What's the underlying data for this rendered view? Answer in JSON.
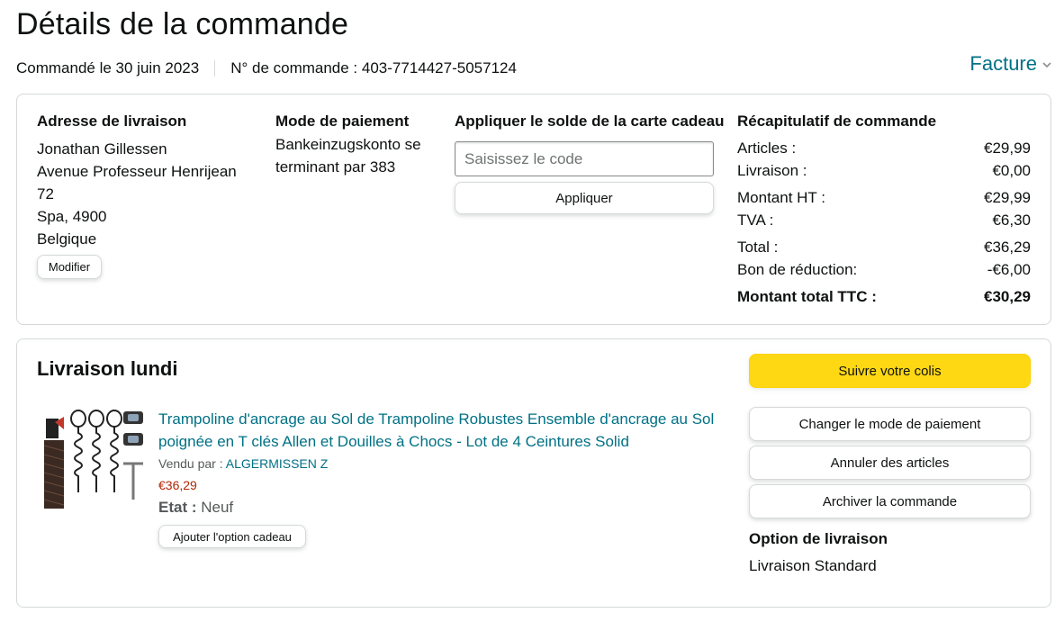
{
  "page": {
    "title": "Détails de la commande",
    "ordered_on": "Commandé le 30 juin 2023",
    "order_number": "N° de commande : 403-7714427-5057124",
    "invoice_label": "Facture"
  },
  "shipping_address": {
    "title": "Adresse de livraison",
    "lines": [
      "Jonathan Gillessen",
      "Avenue Professeur Henrijean",
      "72",
      "Spa, 4900",
      "Belgique"
    ],
    "edit_label": "Modifier"
  },
  "payment": {
    "title": "Mode de paiement",
    "lines": [
      "Bankeinzugskonto se",
      "terminant par 383"
    ]
  },
  "gift_card": {
    "title": "Appliquer le solde de la carte cadeau",
    "placeholder": "Saisissez le code",
    "apply_label": "Appliquer"
  },
  "summary": {
    "title": "Récapitulatif de commande",
    "rows": [
      {
        "label": "Articles :",
        "value": "€29,99"
      },
      {
        "label": "Livraison :",
        "value": "€0,00"
      },
      {
        "label": "Montant HT :",
        "value": "€29,99"
      },
      {
        "label": "TVA :",
        "value": "€6,30"
      },
      {
        "label": "Total :",
        "value": "€36,29"
      },
      {
        "label": "Bon de réduction:",
        "value": "-€6,00"
      },
      {
        "label": "Montant total TTC :",
        "value": "€30,29"
      }
    ]
  },
  "shipment": {
    "title": "Livraison lundi",
    "product": {
      "title": "Trampoline d'ancrage au Sol de Trampoline Robustes Ensemble d'ancrage au Sol poignée en T clés Allen et Douilles à Chocs - Lot de 4 Ceintures Solid",
      "sold_by_label": "Vendu par : ",
      "seller": "ALGERMISSEN Z",
      "price": "€36,29",
      "condition_label": "Etat : ",
      "condition": "Neuf",
      "gift_label": "Ajouter l'option cadeau"
    },
    "actions": {
      "track": "Suivre votre colis",
      "change_payment": "Changer le mode de paiement",
      "cancel_items": "Annuler des articles",
      "archive": "Archiver la commande"
    },
    "delivery_option_title": "Option de livraison",
    "delivery_option_value": "Livraison Standard"
  },
  "colors": {
    "link": "#007185",
    "price": "#b12704",
    "primary_button": "#ffd814",
    "border": "#d5d9d9"
  },
  "icons": {
    "invoice_dropdown": "chevron-down-icon",
    "product_image": "trampoline-anchor-kit-image"
  }
}
